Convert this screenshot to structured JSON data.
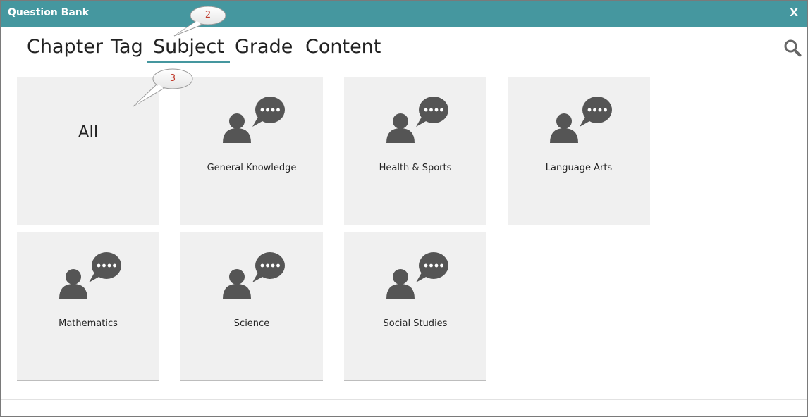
{
  "window": {
    "title": "Question Bank",
    "close_label": "X"
  },
  "colors": {
    "accent": "#45979f",
    "tile_bg": "#f0f0f0",
    "icon": "#555555",
    "callout_text": "#c0392b"
  },
  "tabs": [
    {
      "label": "Chapter",
      "active": false
    },
    {
      "label": "Tag",
      "active": false
    },
    {
      "label": "Subject",
      "active": true
    },
    {
      "label": "Grade",
      "active": false
    },
    {
      "label": "Content",
      "active": false
    }
  ],
  "search": {
    "icon": "search-icon"
  },
  "tiles": [
    {
      "label": "All",
      "icon": null
    },
    {
      "label": "General Knowledge",
      "icon": "person-speech-icon"
    },
    {
      "label": "Health & Sports",
      "icon": "person-speech-icon"
    },
    {
      "label": "Language Arts",
      "icon": "person-speech-icon"
    },
    {
      "label": "Mathematics",
      "icon": "person-speech-icon"
    },
    {
      "label": "Science",
      "icon": "person-speech-icon"
    },
    {
      "label": "Social Studies",
      "icon": "person-speech-icon"
    }
  ],
  "callouts": [
    {
      "number": "2"
    },
    {
      "number": "3"
    }
  ]
}
